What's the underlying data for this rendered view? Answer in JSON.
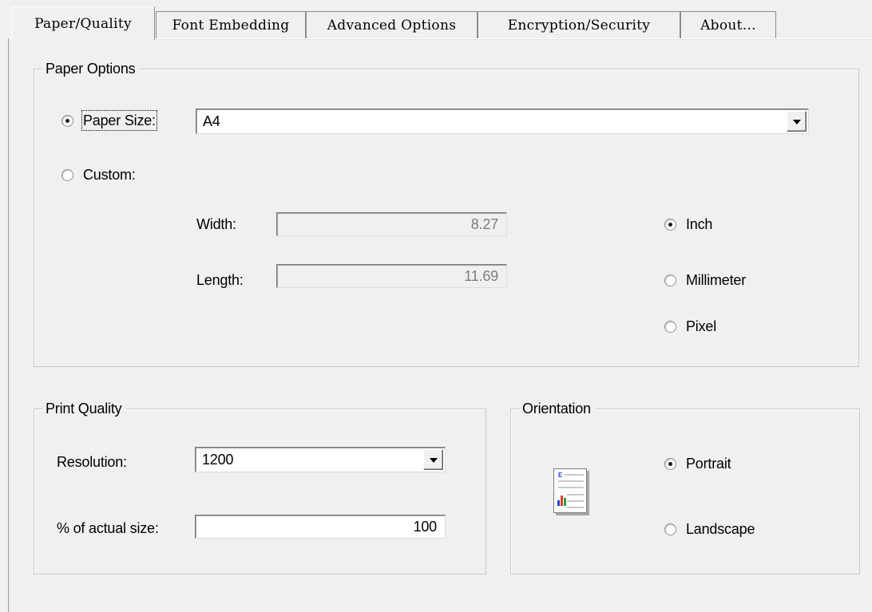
{
  "tabs": [
    {
      "label": "Paper/Quality",
      "active": true
    },
    {
      "label": "Font Embedding",
      "active": false
    },
    {
      "label": "Advanced Options",
      "active": false
    },
    {
      "label": "Encryption/Security",
      "active": false
    },
    {
      "label": "About...",
      "active": false
    }
  ],
  "paper_options": {
    "title": "Paper Options",
    "paper_size_label": "Paper Size:",
    "paper_size_value": "A4",
    "custom_label": "Custom:",
    "width_label": "Width:",
    "width_value": "8.27",
    "length_label": "Length:",
    "length_value": "11.69",
    "units": [
      {
        "label": "Inch",
        "checked": true
      },
      {
        "label": "Millimeter",
        "checked": false
      },
      {
        "label": "Pixel",
        "checked": false
      }
    ]
  },
  "print_quality": {
    "title": "Print Quality",
    "resolution_label": "Resolution:",
    "resolution_value": "1200",
    "scale_label": "% of actual size:",
    "scale_value": "100"
  },
  "orientation": {
    "title": "Orientation",
    "options": [
      {
        "label": "Portrait",
        "checked": true
      },
      {
        "label": "Landscape",
        "checked": false
      }
    ],
    "icon": "portrait-page-icon"
  },
  "colors": {
    "window_bg": "#f0f0f0",
    "field_bg": "#ffffff",
    "disabled_text": "#7d7d7d"
  }
}
